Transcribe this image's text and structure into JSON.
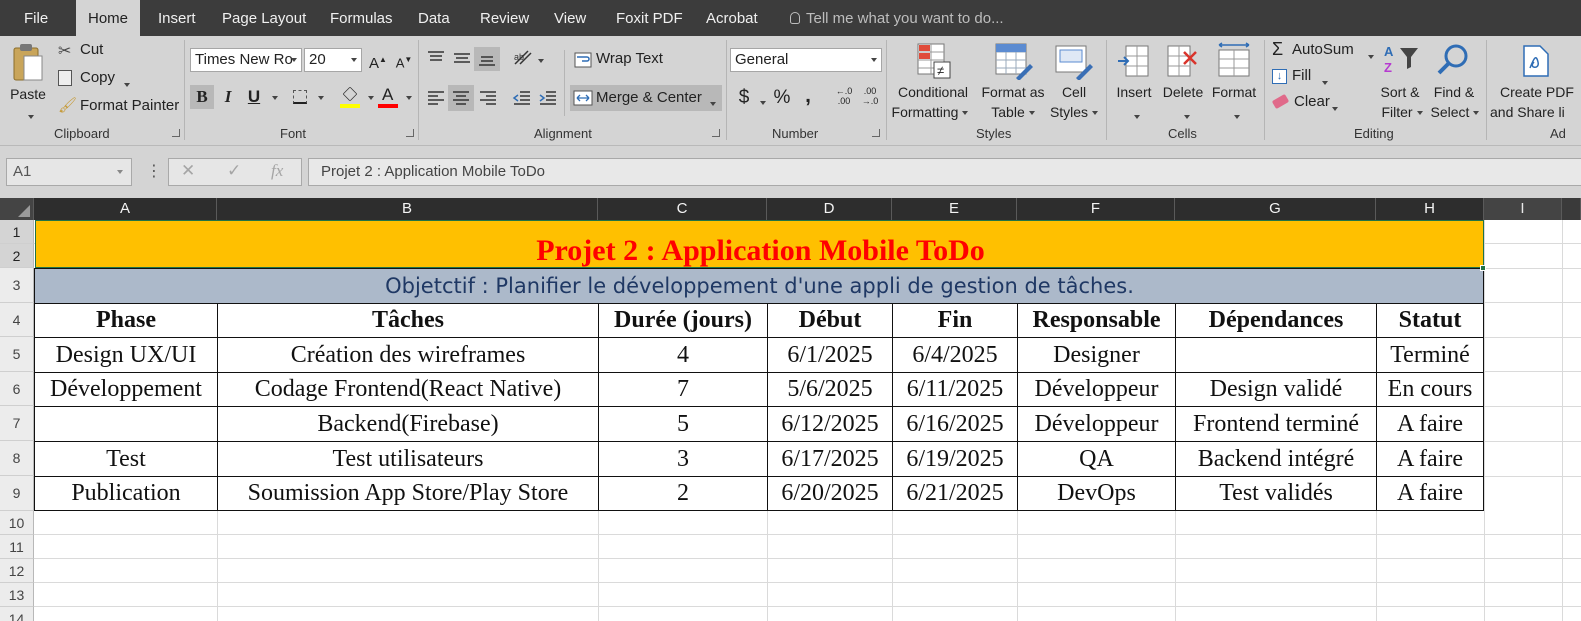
{
  "menubar": {
    "tabs": [
      "File",
      "Home",
      "Insert",
      "Page Layout",
      "Formulas",
      "Data",
      "Review",
      "View",
      "Foxit PDF",
      "Acrobat"
    ],
    "active_tab": "Home",
    "tell_me": "Tell me what you want to do..."
  },
  "ribbon": {
    "clipboard": {
      "paste": "Paste",
      "cut": "Cut",
      "copy": "Copy",
      "format_painter": "Format Painter",
      "label": "Clipboard"
    },
    "font": {
      "family": "Times New Ro",
      "size": "20",
      "bold": "B",
      "italic": "I",
      "underline": "U",
      "label": "Font"
    },
    "alignment": {
      "wrap_text": "Wrap Text",
      "merge_center": "Merge & Center",
      "label": "Alignment"
    },
    "number": {
      "format": "General",
      "currency": "$",
      "percent": "%",
      "comma": ",",
      "label": "Number"
    },
    "styles": {
      "conditional_1": "Conditional",
      "conditional_2": "Formatting",
      "format_table_1": "Format as",
      "format_table_2": "Table",
      "cell_styles_1": "Cell",
      "cell_styles_2": "Styles",
      "label": "Styles"
    },
    "cells": {
      "insert": "Insert",
      "delete": "Delete",
      "format": "Format",
      "label": "Cells"
    },
    "editing": {
      "autosum": "AutoSum",
      "fill": "Fill",
      "clear": "Clear",
      "sort_1": "Sort &",
      "sort_2": "Filter",
      "find_1": "Find &",
      "find_2": "Select",
      "label": "Editing"
    },
    "adobe": {
      "create_1": "Create PDF",
      "create_2": "and Share li",
      "label": "Ad"
    }
  },
  "formula_bar": {
    "name_box": "A1",
    "fx": "fx",
    "content": "Projet 2 : Application Mobile ToDo"
  },
  "sheet": {
    "columns": [
      "A",
      "B",
      "C",
      "D",
      "E",
      "F",
      "G",
      "H",
      "I"
    ],
    "rows": [
      "1",
      "2",
      "3",
      "4",
      "5",
      "6",
      "7",
      "8",
      "9",
      "10",
      "11",
      "12",
      "13",
      "14"
    ],
    "title": "Projet 2 : Application Mobile ToDo",
    "objective": "Objetctif : Planifier le développement d'une appli de gestion de tâches.",
    "headers": [
      "Phase",
      "Tâches",
      "Durée (jours)",
      "Début",
      "Fin",
      "Responsable",
      "Dépendances",
      "Statut"
    ],
    "data_rows": [
      [
        "Design UX/UI",
        "Création des wireframes",
        "4",
        "6/1/2025",
        "6/4/2025",
        "Designer",
        "",
        "Terminé"
      ],
      [
        "Développement",
        "Codage Frontend(React Native)",
        "7",
        "5/6/2025",
        "6/11/2025",
        "Développeur",
        "Design validé",
        "En cours"
      ],
      [
        "",
        "Backend(Firebase)",
        "5",
        "6/12/2025",
        "6/16/2025",
        "Développeur",
        "Frontend terminé",
        "A faire"
      ],
      [
        "Test",
        "Test utilisateurs",
        "3",
        "6/17/2025",
        "6/19/2025",
        "QA",
        "Backend intégré",
        "A faire"
      ],
      [
        "Publication",
        "Soumission App Store/Play Store",
        "2",
        "6/20/2025",
        "6/21/2025",
        "DevOps",
        "Test validés",
        "A faire"
      ]
    ],
    "colors": {
      "title_fill": "#FFC000",
      "title_text": "#FF0000",
      "objective_fill": "#ACB9CA",
      "objective_text": "#1F3864"
    }
  }
}
